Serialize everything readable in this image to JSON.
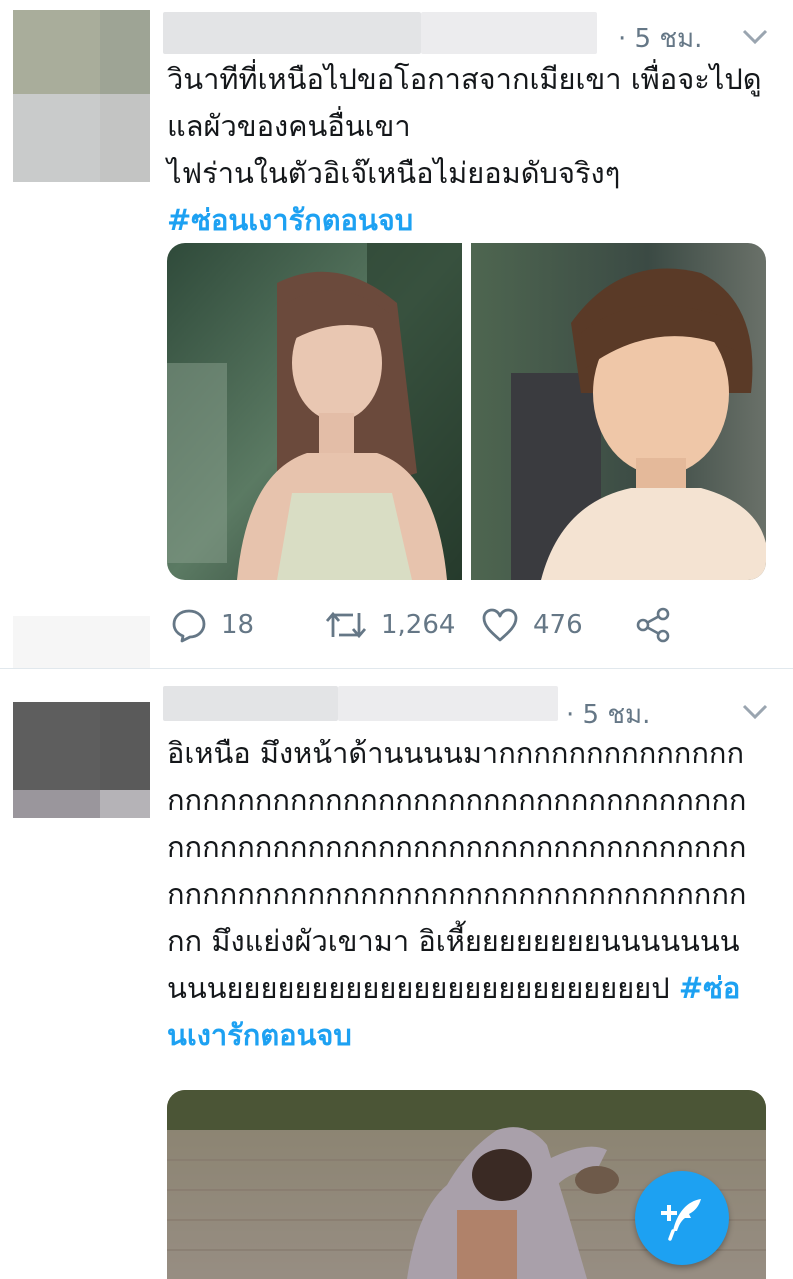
{
  "tweets": [
    {
      "time": "· 5 ชม.",
      "text": "วินาทีที่เหนือไปขอโอกาสจากเมียเขา เพื่อจะไปดูแลผัวของคนอื่นเขา\nไฟร่านในตัวอิเจ๊เหนือไม่ยอมดับจริงๆ",
      "hashtag": "#ซ่อนเงารักตอนจบ",
      "stats": {
        "replies": "18",
        "retweets": "1,264",
        "likes": "476"
      }
    },
    {
      "time": "· 5 ชม.",
      "text": "อิเหนือ มึงหน้าด้านนนนมากกกกกกกกกกกกกกกกกกกกกกกกกกกกกกกกกกกกกกกกกกกกกกกกกกกกกกกกกกกกกกกกกกกกกกกกกกกกกกกกกกกกกกกกกกกกกกกกกกกกกกกกกกกกกกกกกกก มึงแย่งผัวเขามา อิเหี้ยยยยยยยยนนนนนนนนนนยยยยยยยยยยยยยยยยยยยยยยยยยป ",
      "hashtag": "#ซ่อนเงารักตอนจบ"
    }
  ],
  "icons": {
    "reply": "speech-bubble",
    "retweet": "retweet-arrows",
    "like": "heart-outline",
    "share": "share-nodes",
    "menu": "chevron-down",
    "compose": "feather-plus"
  },
  "colors": {
    "accent": "#1da1f2",
    "secondary_text": "#657786"
  }
}
